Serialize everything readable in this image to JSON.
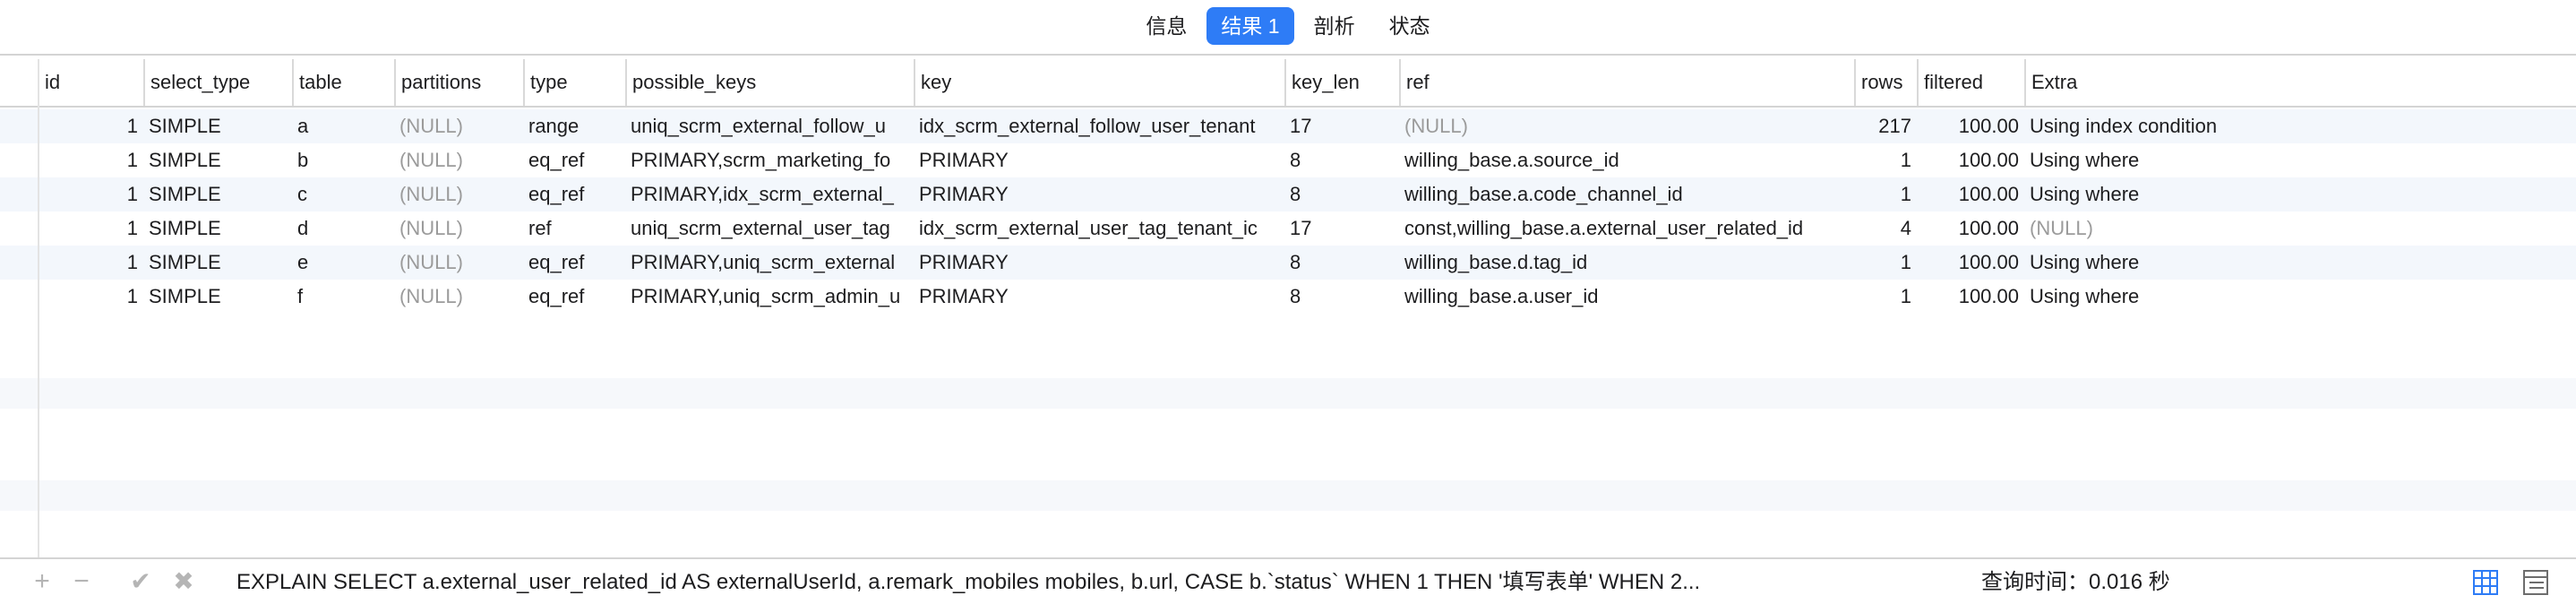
{
  "tabs": [
    "信息",
    "结果 1",
    "剖析",
    "状态"
  ],
  "active_tab_index": 1,
  "columns": [
    "id",
    "select_type",
    "table",
    "partitions",
    "type",
    "possible_keys",
    "key",
    "key_len",
    "ref",
    "rows",
    "filtered",
    "Extra"
  ],
  "rows": [
    [
      "1",
      "SIMPLE",
      "a",
      "(NULL)",
      "range",
      "uniq_scrm_external_follow_u",
      "idx_scrm_external_follow_user_tenant",
      "17",
      "(NULL)",
      "217",
      "100.00",
      "Using index condition"
    ],
    [
      "1",
      "SIMPLE",
      "b",
      "(NULL)",
      "eq_ref",
      "PRIMARY,scrm_marketing_fo",
      "PRIMARY",
      "8",
      "willing_base.a.source_id",
      "1",
      "100.00",
      "Using where"
    ],
    [
      "1",
      "SIMPLE",
      "c",
      "(NULL)",
      "eq_ref",
      "PRIMARY,idx_scrm_external_",
      "PRIMARY",
      "8",
      "willing_base.a.code_channel_id",
      "1",
      "100.00",
      "Using where"
    ],
    [
      "1",
      "SIMPLE",
      "d",
      "(NULL)",
      "ref",
      "uniq_scrm_external_user_tag",
      "idx_scrm_external_user_tag_tenant_ic",
      "17",
      "const,willing_base.a.external_user_related_id",
      "4",
      "100.00",
      "(NULL)"
    ],
    [
      "1",
      "SIMPLE",
      "e",
      "(NULL)",
      "eq_ref",
      "PRIMARY,uniq_scrm_external",
      "PRIMARY",
      "8",
      "willing_base.d.tag_id",
      "1",
      "100.00",
      "Using where"
    ],
    [
      "1",
      "SIMPLE",
      "f",
      "(NULL)",
      "eq_ref",
      "PRIMARY,uniq_scrm_admin_u",
      "PRIMARY",
      "8",
      "willing_base.a.user_id",
      "1",
      "100.00",
      "Using where"
    ]
  ],
  "bottom": {
    "add_icon": "plus-icon",
    "remove_icon": "minus-icon",
    "apply_icon": "check-icon",
    "discard_icon": "x-icon",
    "sql": "EXPLAIN SELECT  a.external_user_related_id AS externalUserId, a.remark_mobiles mobiles, b.url, CASE b.`status`  WHEN 1 THEN '填写表单'  WHEN 2...",
    "query_time": "查询时间：0.016 秒",
    "grid_view_icon": "grid-view-icon",
    "form_view_icon": "form-view-icon"
  },
  "colors": {
    "accent": "#2e7cf6",
    "null_text": "#9b9b9b",
    "alt_row": "#f3f7fc"
  }
}
